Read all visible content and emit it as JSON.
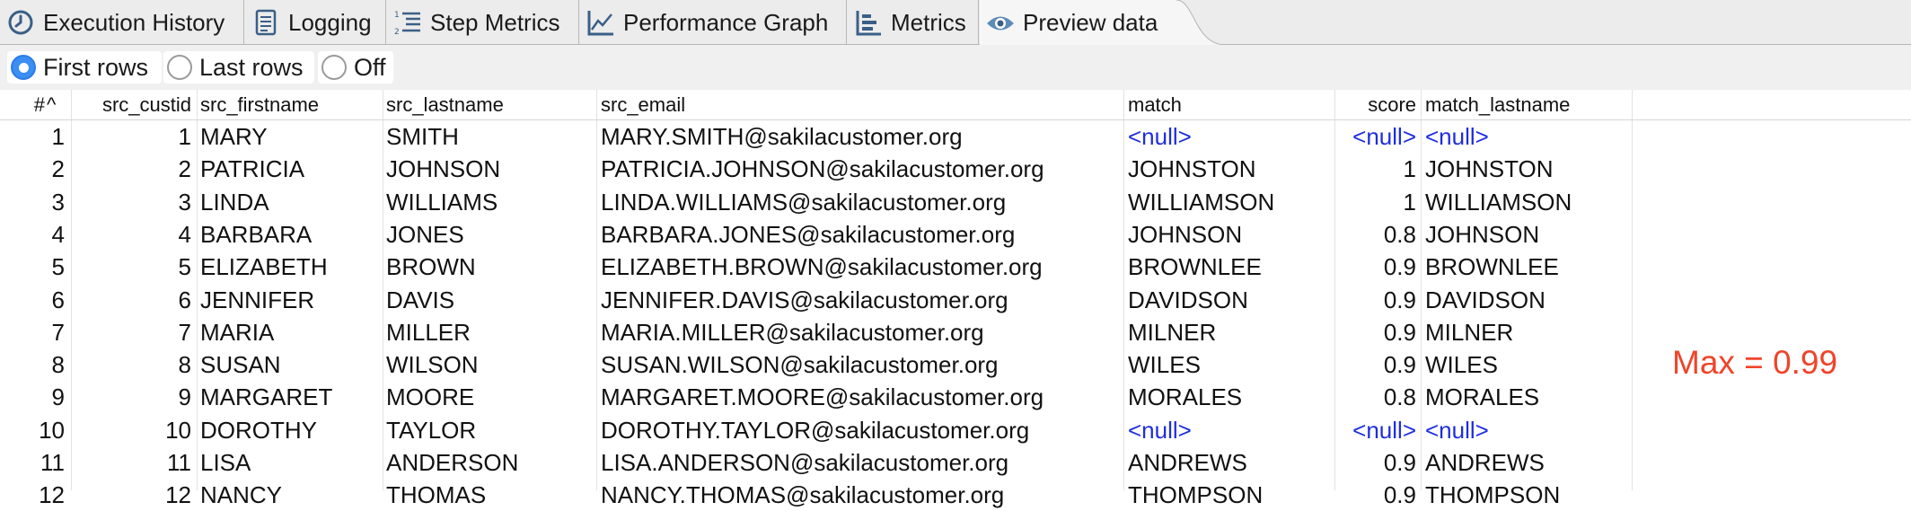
{
  "tabs": [
    {
      "label": "Execution History",
      "icon": "clock-icon"
    },
    {
      "label": "Logging",
      "icon": "document-icon"
    },
    {
      "label": "Step Metrics",
      "icon": "numbered-list-icon"
    },
    {
      "label": "Performance Graph",
      "icon": "line-graph-icon"
    },
    {
      "label": "Metrics",
      "icon": "metrics-icon"
    },
    {
      "label": "Preview data",
      "icon": "eye-icon",
      "active": true
    }
  ],
  "preview_mode": {
    "options": [
      "First rows",
      "Last rows",
      "Off"
    ],
    "selected": "First rows"
  },
  "table": {
    "columns": [
      "#",
      "src_custid",
      "src_firstname",
      "src_lastname",
      "src_email",
      "match",
      "score",
      "match_lastname"
    ],
    "sort_indicator": "^",
    "rows": [
      [
        "1",
        "1",
        "MARY",
        "SMITH",
        "MARY.SMITH@sakilacustomer.org",
        "<null>",
        "<null>",
        "<null>"
      ],
      [
        "2",
        "2",
        "PATRICIA",
        "JOHNSON",
        "PATRICIA.JOHNSON@sakilacustomer.org",
        "JOHNSTON",
        "1",
        "JOHNSTON"
      ],
      [
        "3",
        "3",
        "LINDA",
        "WILLIAMS",
        "LINDA.WILLIAMS@sakilacustomer.org",
        "WILLIAMSON",
        "1",
        "WILLIAMSON"
      ],
      [
        "4",
        "4",
        "BARBARA",
        "JONES",
        "BARBARA.JONES@sakilacustomer.org",
        "JOHNSON",
        "0.8",
        "JOHNSON"
      ],
      [
        "5",
        "5",
        "ELIZABETH",
        "BROWN",
        "ELIZABETH.BROWN@sakilacustomer.org",
        "BROWNLEE",
        "0.9",
        "BROWNLEE"
      ],
      [
        "6",
        "6",
        "JENNIFER",
        "DAVIS",
        "JENNIFER.DAVIS@sakilacustomer.org",
        "DAVIDSON",
        "0.9",
        "DAVIDSON"
      ],
      [
        "7",
        "7",
        "MARIA",
        "MILLER",
        "MARIA.MILLER@sakilacustomer.org",
        "MILNER",
        "0.9",
        "MILNER"
      ],
      [
        "8",
        "8",
        "SUSAN",
        "WILSON",
        "SUSAN.WILSON@sakilacustomer.org",
        "WILES",
        "0.9",
        "WILES"
      ],
      [
        "9",
        "9",
        "MARGARET",
        "MOORE",
        "MARGARET.MOORE@sakilacustomer.org",
        "MORALES",
        "0.8",
        "MORALES"
      ],
      [
        "10",
        "10",
        "DOROTHY",
        "TAYLOR",
        "DOROTHY.TAYLOR@sakilacustomer.org",
        "<null>",
        "<null>",
        "<null>"
      ],
      [
        "11",
        "11",
        "LISA",
        "ANDERSON",
        "LISA.ANDERSON@sakilacustomer.org",
        "ANDREWS",
        "0.9",
        "ANDREWS"
      ],
      [
        "12",
        "12",
        "NANCY",
        "THOMAS",
        "NANCY.THOMAS@sakilacustomer.org",
        "THOMPSON",
        "0.9",
        "THOMPSON"
      ]
    ]
  },
  "annotation": "Max = 0.99",
  "colors": {
    "null_text": "#1e2de0",
    "annotation": "#f0442a",
    "radio_selected": "#3b8ef2"
  }
}
